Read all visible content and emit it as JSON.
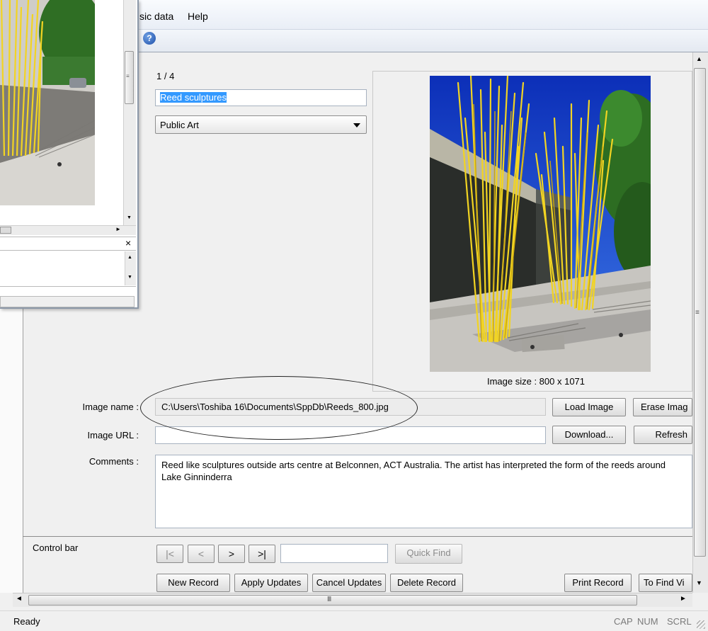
{
  "menu": {
    "items": [
      {
        "label": "sic data"
      },
      {
        "label": "Help"
      }
    ]
  },
  "record": {
    "counter": "1 / 4",
    "title": "Reed sculptures",
    "category": "Public Art"
  },
  "image": {
    "size_label": "Image size : 800 x 1071",
    "name_label": "Image name :",
    "name_value": "C:\\Users\\Toshiba 16\\Documents\\SppDb\\Reeds_800.jpg",
    "url_label": "Image URL :",
    "url_value": "",
    "load_button": "Load Image",
    "erase_button": "Erase Imag",
    "download_button": "Download...",
    "refresh_button": "Refresh"
  },
  "comments": {
    "label": "Comments :",
    "value": "Reed like sculptures outside arts centre at Belconnen, ACT Australia. The artist has interpreted the form of the reeds around Lake Ginninderra"
  },
  "control_bar": {
    "label": "Control bar",
    "first": "|<",
    "prev": "<",
    "next": ">",
    "last": ">|",
    "quickfind_value": "",
    "quickfind_button": "Quick Find",
    "new_record": "New Record",
    "apply_updates": "Apply Updates",
    "cancel_updates": "Cancel Updates",
    "delete_record": "Delete Record",
    "print_record": "Print Record",
    "to_find": "To Find Vi"
  },
  "status": {
    "text": "Ready",
    "cap": "CAP",
    "num": "NUM",
    "scrl": "SCRL"
  },
  "icons": {
    "help": "help-icon",
    "scroll_up": "▲",
    "scroll_down": "▼",
    "scroll_left": "◄",
    "scroll_right": "►",
    "grip": "≡",
    "hgrip": "III",
    "close": "×"
  },
  "colors": {
    "selection": "#3399ff",
    "reeds": "#f2d422",
    "sky": "#1f4fd6"
  }
}
